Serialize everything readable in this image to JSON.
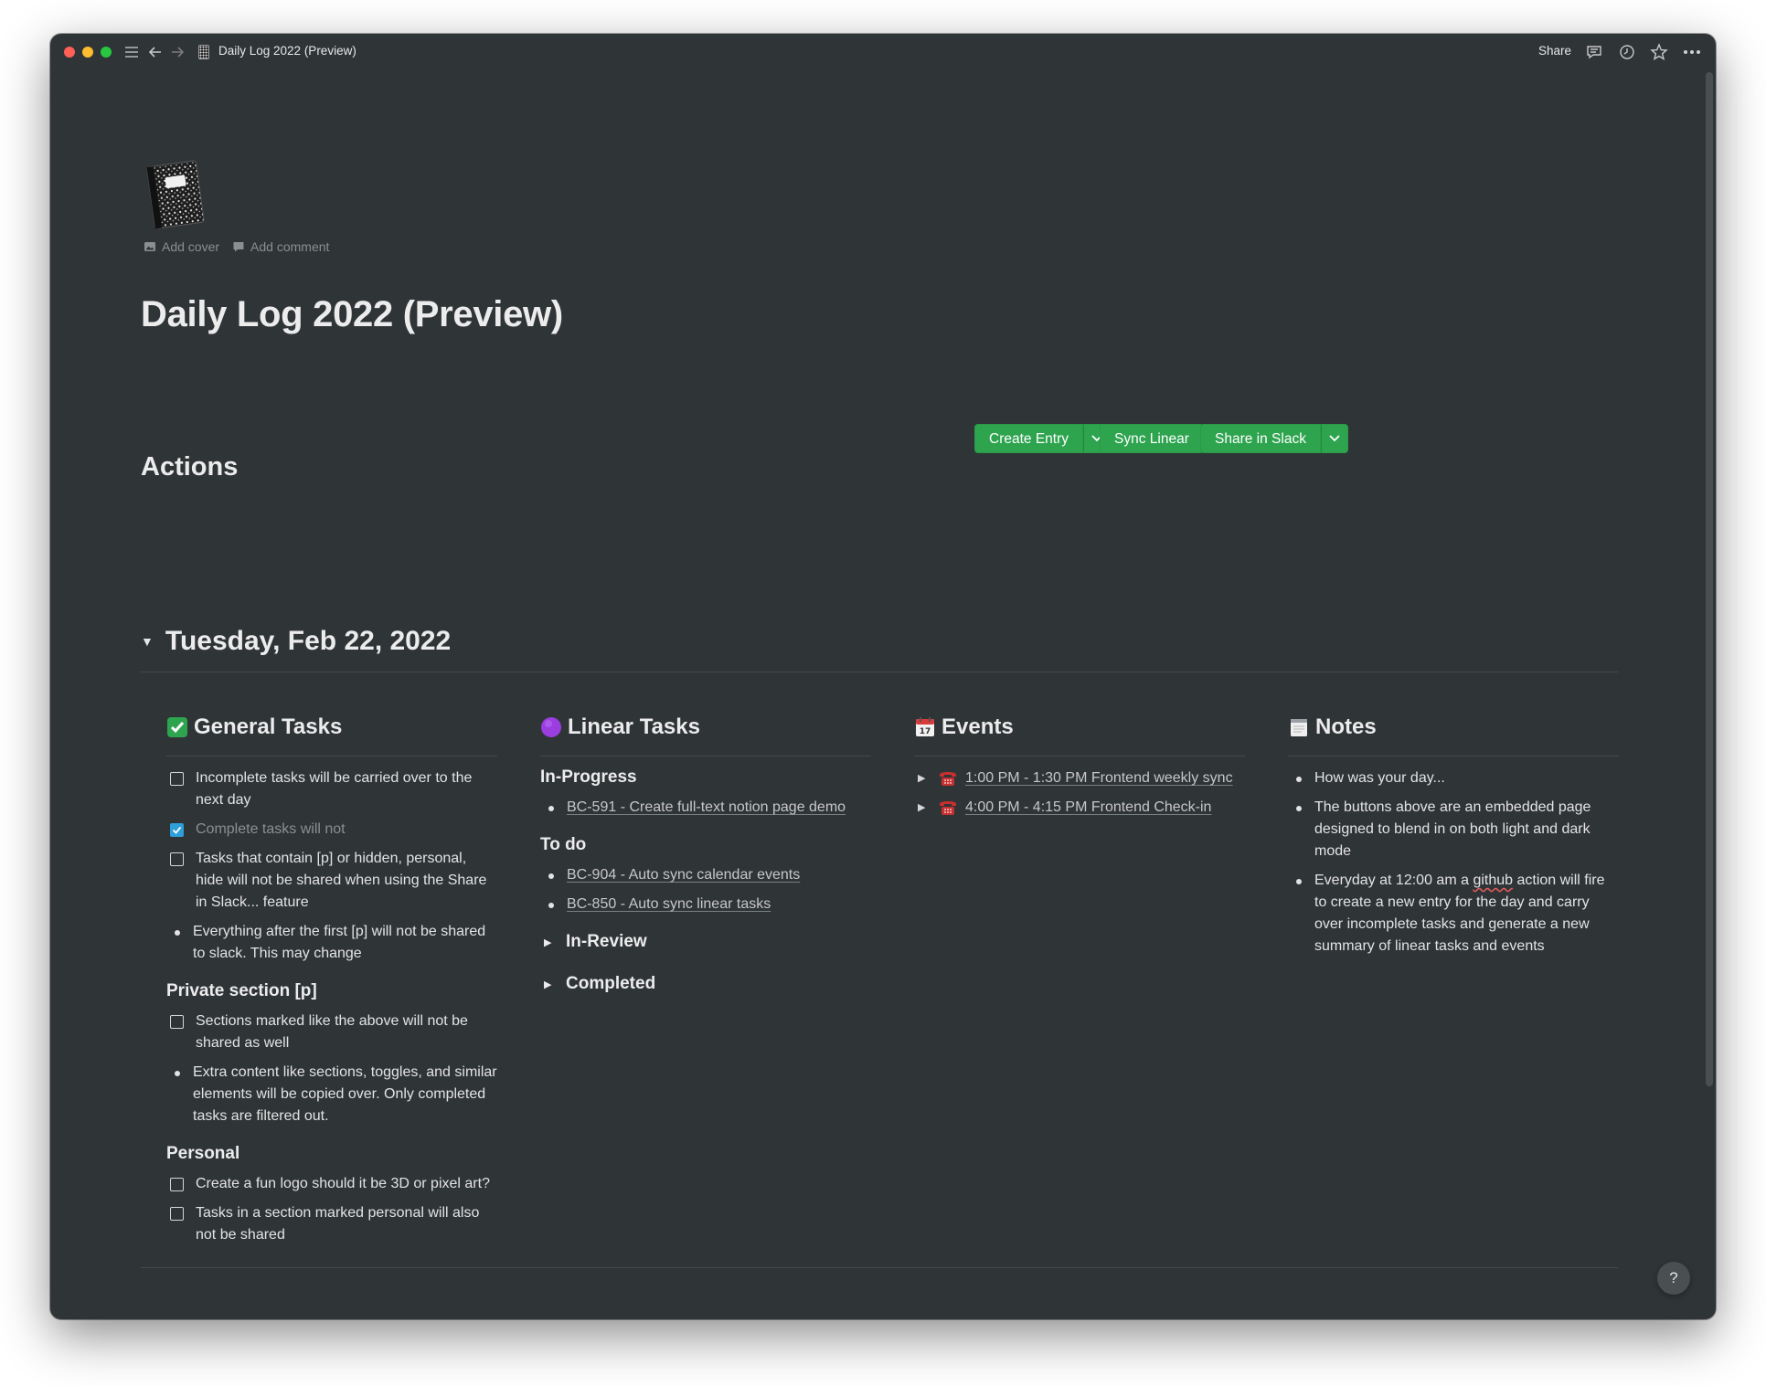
{
  "window": {
    "title": "Daily Log 2022 (Preview)",
    "share_label": "Share"
  },
  "page": {
    "add_cover": "Add cover",
    "add_comment": "Add comment",
    "title": "Daily Log 2022 (Preview)"
  },
  "actions": {
    "heading": "Actions",
    "create_entry": "Create Entry",
    "sync_linear": "Sync Linear",
    "share_slack": "Share in Slack"
  },
  "day": {
    "date": "Tuesday, Feb 22, 2022"
  },
  "general": {
    "heading": "General Tasks",
    "items": [
      "Incomplete tasks will be carried over to the next day",
      "Complete tasks will not",
      "Tasks that contain [p] or hidden, personal, hide will not be shared when using the Share in Slack... feature",
      "Everything after the first [p] will not be shared to slack. This may change"
    ],
    "private_heading": "Private section [p]",
    "private_items": [
      "Sections marked like the above will not be shared as well",
      "Extra content like sections, toggles, and similar elements will be copied over. Only completed tasks are filtered out."
    ],
    "personal_heading": "Personal",
    "personal_items": [
      "Create a fun logo should it be 3D or pixel art?",
      "Tasks in a section marked personal will also not be shared"
    ]
  },
  "linear": {
    "heading": "Linear Tasks",
    "in_progress": "In-Progress",
    "in_progress_items": [
      "BC-591 - Create full-text notion page demo"
    ],
    "todo": "To do",
    "todo_items": [
      "BC-904 - Auto sync calendar events",
      "BC-850 - Auto sync linear tasks"
    ],
    "in_review": "In-Review",
    "completed": "Completed"
  },
  "events": {
    "heading": "Events",
    "items": [
      "1:00 PM - 1:30 PM Frontend weekly sync",
      "4:00 PM - 4:15 PM Frontend Check-in"
    ]
  },
  "notes": {
    "heading": "Notes",
    "items": [
      "How was your day...",
      "The buttons above are an embedded page designed to blend in on both light and dark mode"
    ],
    "last_pre": "Everyday at 12:00 am a ",
    "last_squiggle": "github",
    "last_post": " action will fire to create a new entry for the day and carry over incomplete tasks and generate a new summary of linear tasks and events"
  },
  "help_label": "?",
  "colors": {
    "background": "#2f3437",
    "button_green": "#2ea44f",
    "checkbox_blue": "#2e9fd8"
  },
  "icons": [
    "sidebar-menu-icon",
    "back-arrow-icon",
    "forward-arrow-icon",
    "comment-icon",
    "clock-icon",
    "star-icon",
    "more-icon",
    "notebook-icon",
    "image-icon",
    "check-mark-emoji",
    "purple-circle-emoji",
    "calendar-emoji",
    "notepad-emoji",
    "telephone-icon",
    "chevron-down-icon"
  ]
}
